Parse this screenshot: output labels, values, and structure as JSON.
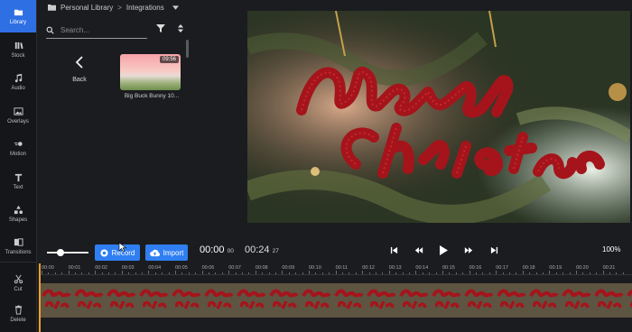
{
  "rail": {
    "items": [
      {
        "label": "Library",
        "icon": "folder-icon",
        "active": true
      },
      {
        "label": "Stock",
        "icon": "stock-icon"
      },
      {
        "label": "Audio",
        "icon": "music-note-icon"
      },
      {
        "label": "Overlays",
        "icon": "image-icon"
      },
      {
        "label": "Motion",
        "icon": "motion-icon"
      },
      {
        "label": "Text",
        "icon": "text-icon"
      },
      {
        "label": "Shapes",
        "icon": "shapes-icon"
      },
      {
        "label": "Transitions",
        "icon": "transitions-icon"
      }
    ],
    "tools": [
      {
        "label": "Cut",
        "icon": "scissors-icon"
      },
      {
        "label": "Delete",
        "icon": "trash-icon"
      }
    ]
  },
  "library": {
    "crumb_root": "Personal Library",
    "crumb_sep": ">",
    "crumb_current": "Integrations",
    "search_placeholder": "Search...",
    "back_label": "Back",
    "item": {
      "duration": "09:56",
      "title": "Big Buck Bunny 10..."
    }
  },
  "actions": {
    "record": "Record",
    "import": "Import"
  },
  "transport": {
    "current_main": "00:00",
    "current_frames": "00",
    "total_main": "00:24",
    "total_frames": "27",
    "zoom": "100%"
  },
  "timeline": {
    "ticks": [
      "00:00",
      "00:01",
      "00:02",
      "00:03",
      "00:04",
      "00:05",
      "00:06",
      "00:07",
      "00:08",
      "00:09",
      "00:10",
      "00:11",
      "00:12",
      "00:13",
      "00:14",
      "00:15",
      "00:16",
      "00:17",
      "00:18",
      "00:19",
      "00:20",
      "00:21"
    ]
  },
  "colors": {
    "accent": "#2f7ff2",
    "active_rail": "#2f6fe4",
    "playhead": "#f0a030",
    "ornament_red": "#a5141b"
  }
}
